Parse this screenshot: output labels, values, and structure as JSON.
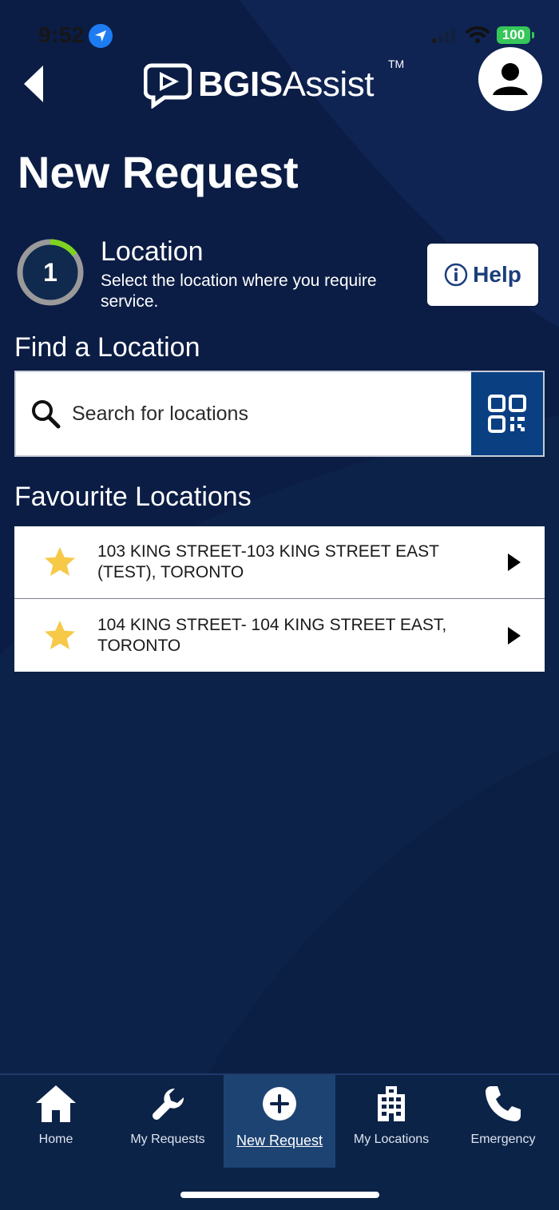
{
  "status_bar": {
    "time": "9:52",
    "battery": "100"
  },
  "header": {
    "brand_bold": "BGIS",
    "brand_light": "Assist",
    "trademark": "TM"
  },
  "page": {
    "title": "New Request"
  },
  "step": {
    "number": "1",
    "title": "Location",
    "description": "Select the location where you require service.",
    "progress": 0.15
  },
  "help_button": {
    "label": "Help"
  },
  "find_location": {
    "heading": "Find a Location",
    "search_placeholder": "Search for locations"
  },
  "favourites": {
    "heading": "Favourite Locations",
    "items": [
      {
        "label": "103 KING STREET-103 KING STREET EAST (TEST), TORONTO"
      },
      {
        "label": "104 KING STREET- 104 KING STREET EAST, TORONTO"
      }
    ]
  },
  "bottom_nav": {
    "items": [
      {
        "label": "Home",
        "icon": "home-icon"
      },
      {
        "label": "My Requests",
        "icon": "wrench-icon"
      },
      {
        "label": "New Request",
        "icon": "plus-circle-icon",
        "active": true
      },
      {
        "label": "My Locations",
        "icon": "building-icon"
      },
      {
        "label": "Emergency",
        "icon": "phone-icon"
      }
    ]
  },
  "colors": {
    "background": "#0b1d45",
    "accent_blue": "#0a3f82",
    "progress_green": "#7ed321",
    "star_yellow": "#f7c948",
    "battery_green": "#35c759"
  }
}
